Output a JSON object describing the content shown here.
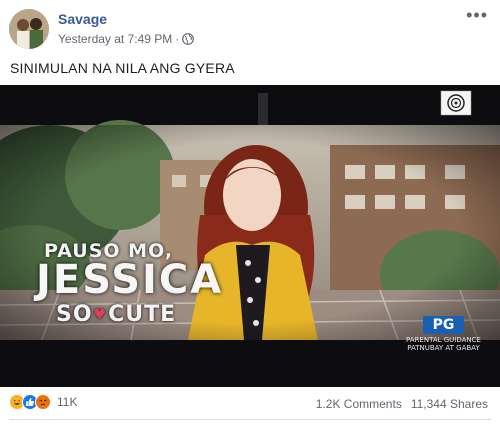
{
  "post": {
    "author": "Savage",
    "timestamp": "Yesterday at 7:49 PM",
    "separator": "·",
    "privacy_icon": "globe-icon",
    "more_icon": "more-options-icon",
    "caption": "SINIMULAN NA NILA ANG GYERA"
  },
  "video": {
    "title_line1": "PAUSO MO,",
    "title_line2": "JESSICA",
    "title_line3a": "SO",
    "title_line3b": "CUTE",
    "rating": "PG",
    "guidance_line1": "PARENTAL GUIDANCE",
    "guidance_line2": "PATNUBAY AT GABAY",
    "network_logo": "abs-cbn-logo"
  },
  "footer": {
    "reactions": [
      "haha",
      "like",
      "angry"
    ],
    "reaction_count": "11K",
    "comments": "1.2K Comments",
    "shares": "11,344 Shares"
  },
  "colors": {
    "author_link": "#385898",
    "meta": "#616770",
    "like_blue": "#1877f2",
    "pg_badge": "#1b5fb0",
    "jacket": "#e6b52a",
    "hair": "#8a2a1a"
  }
}
